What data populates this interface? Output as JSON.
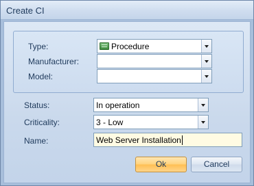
{
  "window": {
    "title": "Create CI"
  },
  "fields": {
    "type": {
      "label": "Type:",
      "value": "Procedure",
      "icon": "procedure-icon"
    },
    "manufacturer": {
      "label": "Manufacturer:",
      "value": ""
    },
    "model": {
      "label": "Model:",
      "value": ""
    },
    "status": {
      "label": "Status:",
      "value": "In operation"
    },
    "criticality": {
      "label": "Criticality:",
      "value": "3 - Low"
    },
    "name": {
      "label": "Name:",
      "value": "Web Server Installation"
    }
  },
  "buttons": {
    "ok": "Ok",
    "cancel": "Cancel"
  },
  "colors": {
    "ok_button": "#ffd27c",
    "name_field_bg": "#fffbe3"
  }
}
